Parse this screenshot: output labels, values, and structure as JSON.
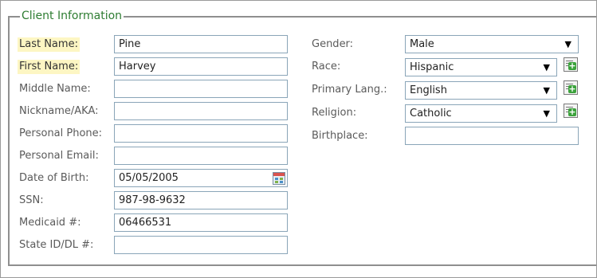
{
  "section": {
    "title": "Client Information"
  },
  "left_fields": [
    {
      "label": "Last Name:",
      "value": "Pine",
      "required": true
    },
    {
      "label": "First Name:",
      "value": "Harvey",
      "required": true
    },
    {
      "label": "Middle Name:",
      "value": ""
    },
    {
      "label": "Nickname/AKA:",
      "value": ""
    },
    {
      "label": "Personal Phone:",
      "value": ""
    },
    {
      "label": "Personal Email:",
      "value": ""
    },
    {
      "label": "Date of Birth:",
      "value": "05/05/2005"
    },
    {
      "label": "SSN:",
      "value": "987-98-9632"
    },
    {
      "label": "Medicaid #:",
      "value": "06466531"
    },
    {
      "label": "State ID/DL #:",
      "value": ""
    }
  ],
  "right_fields": {
    "gender": {
      "label": "Gender:",
      "value": "Male"
    },
    "race": {
      "label": "Race:",
      "value": "Hispanic"
    },
    "primary_lang": {
      "label": "Primary Lang.:",
      "value": "English"
    },
    "religion": {
      "label": "Religion:",
      "value": "Catholic"
    },
    "birthplace": {
      "label": "Birthplace:",
      "value": ""
    }
  },
  "icons": {
    "dropdown_arrow": "▼",
    "add_plus": "+"
  },
  "colors": {
    "legend_text": "#2e7d32",
    "required_highlight": "#fdf6c3",
    "input_border": "#8aa5b8",
    "add_icon_green": "#3ca23c"
  }
}
